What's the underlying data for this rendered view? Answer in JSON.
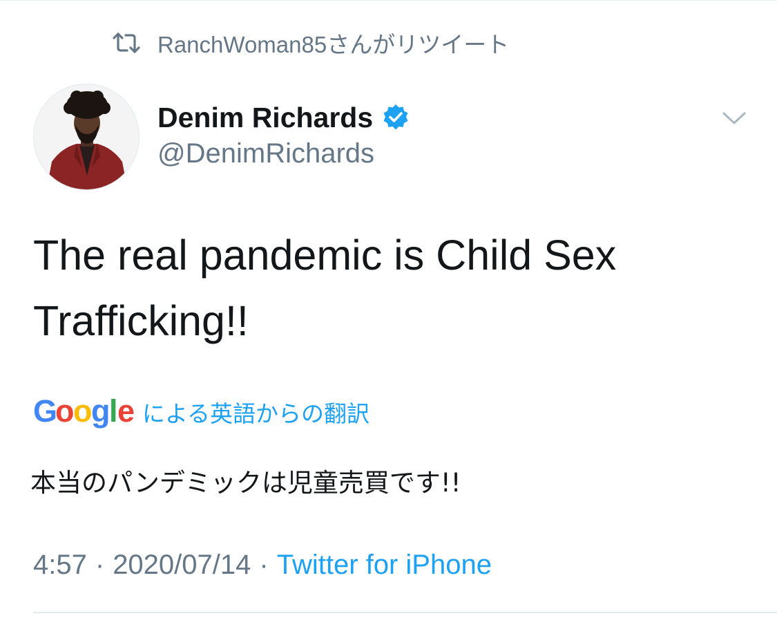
{
  "retweet": {
    "icon": "retweet-icon",
    "text": "RanchWoman85さんがリツイート"
  },
  "author": {
    "display_name": "Denim Richards",
    "handle": "@DenimRichards",
    "verified": true,
    "verified_color": "#1da1f2"
  },
  "tweet": {
    "text": "The real pandemic is Child Sex Trafficking!!"
  },
  "translation": {
    "provider_logo": "google-logo",
    "label": "による英語からの翻訳",
    "text": "本当のパンデミックは児童売買です!!"
  },
  "meta": {
    "time": "4:57",
    "separator": "·",
    "date": "2020/07/14",
    "source": "Twitter for iPhone"
  },
  "colors": {
    "link": "#1da1f2",
    "secondary_text": "#657786",
    "primary_text": "#14171a"
  }
}
